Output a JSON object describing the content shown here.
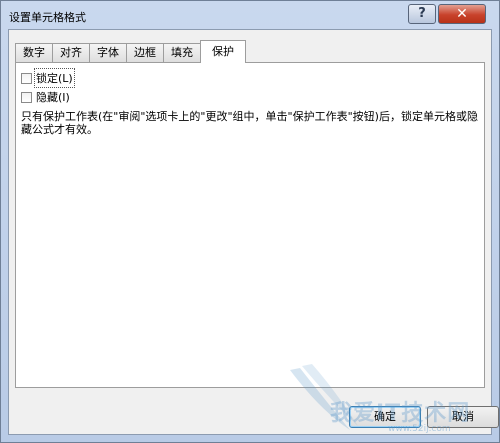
{
  "window": {
    "title": "设置单元格格式",
    "help_label": "?",
    "close_label": "✕"
  },
  "tabs": [
    {
      "label": "数字"
    },
    {
      "label": "对齐"
    },
    {
      "label": "字体"
    },
    {
      "label": "边框"
    },
    {
      "label": "填充"
    },
    {
      "label": "保护"
    }
  ],
  "active_tab": "保护",
  "protection": {
    "locked": {
      "label": "锁定(L)",
      "checked": false
    },
    "hidden": {
      "label": "隐藏(I)",
      "checked": false
    },
    "description": "只有保护工作表(在\"审阅\"选项卡上的\"更改\"组中，单击\"保护工作表\"按钮)后，锁定单元格或隐藏公式才有效。"
  },
  "buttons": {
    "ok": "确定",
    "cancel": "取消"
  },
  "watermark": {
    "text": "我爱IT技术网",
    "url": "www.52ij.com"
  },
  "colors": {
    "title_bar": "#c4d4ec",
    "close_button": "#c8422b",
    "client_bg": "#f0f0f0",
    "panel_bg": "#ffffff"
  }
}
